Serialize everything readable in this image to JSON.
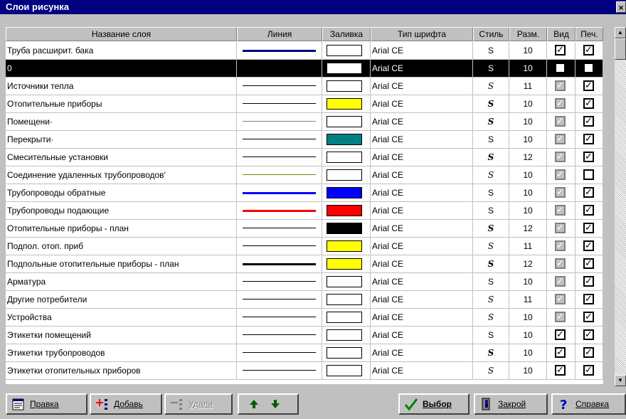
{
  "window": {
    "title": "Слои рисунка",
    "close_glyph": "×"
  },
  "columns": [
    "Название слоя",
    "Линия",
    "Заливка",
    "Тип шрифта",
    "Стиль",
    "Разм.",
    "Вид",
    "Печ."
  ],
  "layers": [
    {
      "name": "Труба расширит. бака",
      "line_color": "#000080",
      "line_width": 3,
      "fill": "#ffffff",
      "font": "Arial CE",
      "style": "S",
      "style_kind": "s",
      "size": "10",
      "visible": true,
      "visible_enabled": true,
      "print": true
    },
    {
      "name": "0",
      "line_color": "#000000",
      "line_width": 1,
      "fill": "#ffffff",
      "font": "Arial CE",
      "style": "S",
      "style_kind": "s",
      "size": "10",
      "visible": true,
      "visible_enabled": true,
      "print": true,
      "selected": true
    },
    {
      "name": "Источники тепла",
      "line_color": "#000000",
      "line_width": 1,
      "fill": "#ffffff",
      "font": "Arial CE",
      "style": "S",
      "style_kind": "i",
      "size": "11",
      "visible": true,
      "visible_enabled": false,
      "print": true
    },
    {
      "name": "Отопительные приборы",
      "line_color": "#000000",
      "line_width": 1,
      "fill": "#ffff00",
      "font": "Arial CE",
      "style": "S",
      "style_kind": "bi",
      "size": "10",
      "visible": true,
      "visible_enabled": false,
      "print": true
    },
    {
      "name": "Помещени·",
      "line_color": "#808080",
      "line_width": 1,
      "fill": "#ffffff",
      "font": "Arial CE",
      "style": "S",
      "style_kind": "bi",
      "size": "10",
      "visible": true,
      "visible_enabled": false,
      "print": true
    },
    {
      "name": "Перекрыти·",
      "line_color": "#000000",
      "line_width": 1,
      "fill": "#008080",
      "font": "Arial CE",
      "style": "S",
      "style_kind": "s",
      "size": "10",
      "visible": true,
      "visible_enabled": false,
      "print": true
    },
    {
      "name": "Смесительные установки",
      "line_color": "#000000",
      "line_width": 1,
      "fill": "#ffffff",
      "font": "Arial CE",
      "style": "S",
      "style_kind": "bi",
      "size": "12",
      "visible": true,
      "visible_enabled": false,
      "print": true
    },
    {
      "name": "Соединение удаленных трубопроводов'",
      "line_color": "#808000",
      "line_width": 1,
      "fill": "#ffffff",
      "font": "Arial CE",
      "style": "S",
      "style_kind": "i",
      "size": "10",
      "visible": true,
      "visible_enabled": false,
      "print": false
    },
    {
      "name": "Трубопроводы обратные",
      "line_color": "#0000ff",
      "line_width": 3,
      "fill": "#0000ff",
      "font": "Arial CE",
      "style": "S",
      "style_kind": "s",
      "size": "10",
      "visible": true,
      "visible_enabled": false,
      "print": true
    },
    {
      "name": "Трубопроводы подающие",
      "line_color": "#ff0000",
      "line_width": 3,
      "fill": "#ff0000",
      "font": "Arial CE",
      "style": "S",
      "style_kind": "s",
      "size": "10",
      "visible": true,
      "visible_enabled": false,
      "print": true
    },
    {
      "name": "Отопительные приборы - план",
      "line_color": "#000000",
      "line_width": 1,
      "fill": "#000000",
      "font": "Arial CE",
      "style": "S",
      "style_kind": "bi",
      "size": "12",
      "visible": true,
      "visible_enabled": false,
      "print": true
    },
    {
      "name": "Подпол. отоп. приб",
      "line_color": "#000000",
      "line_width": 1,
      "fill": "#ffff00",
      "font": "Arial CE",
      "style": "S",
      "style_kind": "i",
      "size": "11",
      "visible": true,
      "visible_enabled": false,
      "print": true
    },
    {
      "name": "Подпольные отопительные приборы - план",
      "line_color": "#000000",
      "line_width": 3,
      "fill": "#ffff00",
      "font": "Arial CE",
      "style": "S",
      "style_kind": "bi",
      "size": "12",
      "visible": true,
      "visible_enabled": false,
      "print": true
    },
    {
      "name": "Арматура",
      "line_color": "#000000",
      "line_width": 1,
      "fill": "#ffffff",
      "font": "Arial CE",
      "style": "S",
      "style_kind": "s",
      "size": "10",
      "visible": true,
      "visible_enabled": false,
      "print": true
    },
    {
      "name": "Другие потребители",
      "line_color": "#000000",
      "line_width": 1,
      "fill": "#ffffff",
      "font": "Arial CE",
      "style": "S",
      "style_kind": "i",
      "size": "11",
      "visible": true,
      "visible_enabled": false,
      "print": true
    },
    {
      "name": "Устройства",
      "line_color": "#000000",
      "line_width": 1,
      "fill": "#ffffff",
      "font": "Arial CE",
      "style": "S",
      "style_kind": "i",
      "size": "10",
      "visible": true,
      "visible_enabled": false,
      "print": true
    },
    {
      "name": "Этикетки помещений",
      "line_color": "#000000",
      "line_width": 1,
      "fill": "#ffffff",
      "font": "Arial CE",
      "style": "S",
      "style_kind": "s",
      "size": "10",
      "visible": true,
      "visible_enabled": true,
      "print": true
    },
    {
      "name": "Этикетки трубопроводов",
      "line_color": "#000000",
      "line_width": 1,
      "fill": "#ffffff",
      "font": "Arial CE",
      "style": "S",
      "style_kind": "bi",
      "size": "10",
      "visible": true,
      "visible_enabled": true,
      "print": true
    },
    {
      "name": "Этикетки отопительных приборов",
      "line_color": "#000000",
      "line_width": 1,
      "fill": "#ffffff",
      "font": "Arial CE",
      "style": "S",
      "style_kind": "i",
      "size": "10",
      "visible": true,
      "visible_enabled": true,
      "print": true
    }
  ],
  "toolbar": {
    "edit": "Правка",
    "add": "Добавь",
    "delete": "Удали",
    "select": "Выбор",
    "close": "Закрой",
    "help": "Справка"
  }
}
